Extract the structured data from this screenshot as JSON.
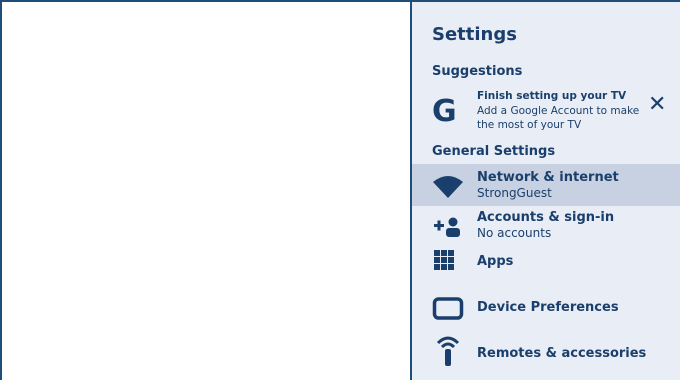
{
  "settings": {
    "title": "Settings",
    "suggestions_header": "Suggestions",
    "suggestion": {
      "icon": "google-g-icon",
      "title": "Finish setting up your TV",
      "text": "Add a Google Account to make the most of your TV",
      "dismiss_icon": "close-icon"
    },
    "general_header": "General Settings",
    "items": [
      {
        "icon": "wifi-icon",
        "title": "Network & internet",
        "subtitle": "StrongGuest",
        "selected": true
      },
      {
        "icon": "add-account-icon",
        "title": "Accounts & sign-in",
        "subtitle": "No accounts",
        "selected": false
      },
      {
        "icon": "apps-grid-icon",
        "title": "Apps",
        "subtitle": "",
        "selected": false
      },
      {
        "icon": "display-icon",
        "title": "Device Preferences",
        "subtitle": "",
        "selected": false
      },
      {
        "icon": "remote-icon",
        "title": "Remotes & accessories",
        "subtitle": "",
        "selected": false
      }
    ]
  },
  "colors": {
    "panel_bg": "#e9edf5",
    "selected_bg": "#c7d1e2",
    "text": "#1b3f6c",
    "frame_border": "#1e4d7a"
  }
}
